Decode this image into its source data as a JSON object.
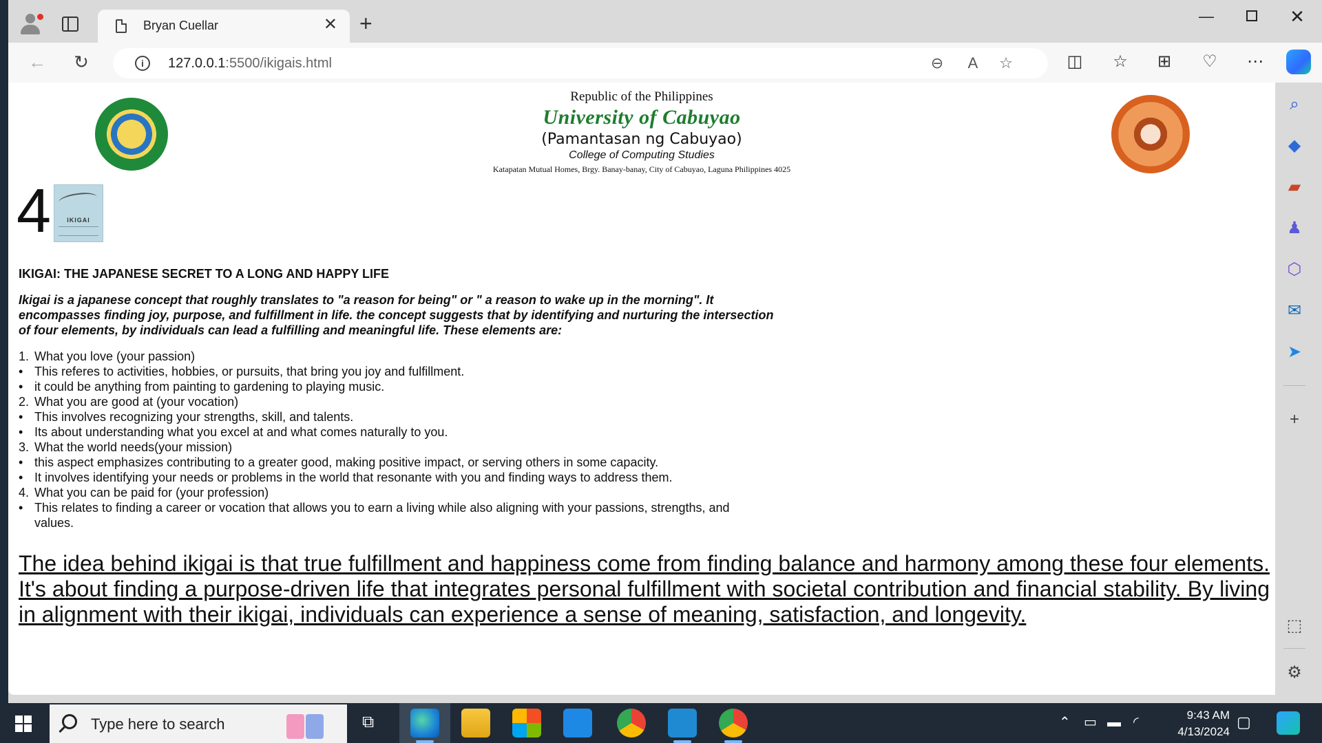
{
  "browser": {
    "tab_title": "Bryan Cuellar",
    "new_tab_symbol": "+",
    "tab_close_symbol": "✕",
    "url_host": "127.0.0.1",
    "url_rest": ":5500/ikigais.html"
  },
  "letterhead": {
    "republic": "Republic of the Philippines",
    "university": "University of Cabuyao",
    "tagalog": "(Pamantasan ng Cabuyao)",
    "college": "College of Computing Studies",
    "address": "Katapatan Mutual Homes, Brgy. Banay-banay, City of Cabuyao, Laguna Philippines 4025"
  },
  "chapter": {
    "number": "4",
    "book_label": "IKIGAI"
  },
  "article": {
    "heading": "IKIGAI: THE JAPANESE SECRET TO A LONG AND HAPPY LIFE",
    "intro": "Ikigai is a japanese concept that roughly translates to \"a reason for being\" or \" a reason to wake up in the morning\". It encompasses finding joy, purpose, and fulfillment in life. the concept suggests that by identifying and nurturing the intersection of four elements, by individuals can lead a fulfilling and meaningful life. These elements are:",
    "items": [
      {
        "marker": "1.",
        "text": "What you love (your passion)"
      },
      {
        "marker": "•",
        "text": "This referes to activities, hobbies, or pursuits, that bring you joy and fulfillment."
      },
      {
        "marker": "•",
        "text": "it could be anything from painting to gardening to playing music."
      },
      {
        "marker": "2.",
        "text": "What you are good at (your vocation)"
      },
      {
        "marker": "•",
        "text": "This involves recognizing your strengths, skill, and talents."
      },
      {
        "marker": "•",
        "text": "Its about understanding what you excel at and what comes naturally to you."
      },
      {
        "marker": "3.",
        "text": "What the world needs(your mission)"
      },
      {
        "marker": "•",
        "text": "this aspect emphasizes contributing to a greater good, making positive impact, or serving others in some capacity."
      },
      {
        "marker": "•",
        "text": "It involves identifying your needs or problems in the world that resonante with you and finding ways to address them."
      },
      {
        "marker": "4.",
        "text": "What you can be paid for (your profession)"
      },
      {
        "marker": "•",
        "text": "This relates to finding a career or vocation that allows you to earn a living while also aligning with your passions, strengths, and values."
      }
    ],
    "closing": "The idea behind ikigai is that true fulfillment and happiness come from finding balance and harmony among these four elements. It's about finding a purpose-driven life that integrates personal fulfillment with societal contribution and financial stability. By living in alignment with their ikigai, individuals can experience a sense of meaning, satisfaction, and longevity."
  },
  "taskbar": {
    "search_placeholder": "Type here to search",
    "time": "9:43 AM",
    "date": "4/13/2024"
  },
  "colors": {
    "university_green": "#1e7d2f",
    "taskbar_bg": "#1f2a36",
    "chrome_bg": "#dadada"
  },
  "icons": [
    "profile-icon",
    "tab-actions-icon",
    "page-icon",
    "back-icon",
    "reload-icon",
    "info-icon",
    "zoom-out-icon",
    "read-aloud-icon",
    "favorite-star-icon",
    "split-screen-icon",
    "favorites-icon",
    "collections-icon",
    "browser-essentials-icon",
    "more-icon",
    "copilot-icon",
    "search-icon",
    "shopping-tag-icon",
    "toolbox-icon",
    "games-icon",
    "microsoft365-icon",
    "outlook-icon",
    "send-icon",
    "add-icon",
    "screenshot-icon",
    "settings-icon",
    "windows-start-icon",
    "task-view-icon",
    "edge-icon",
    "file-explorer-icon",
    "store-icon",
    "mail-icon",
    "chrome-icon",
    "vscode-icon"
  ]
}
